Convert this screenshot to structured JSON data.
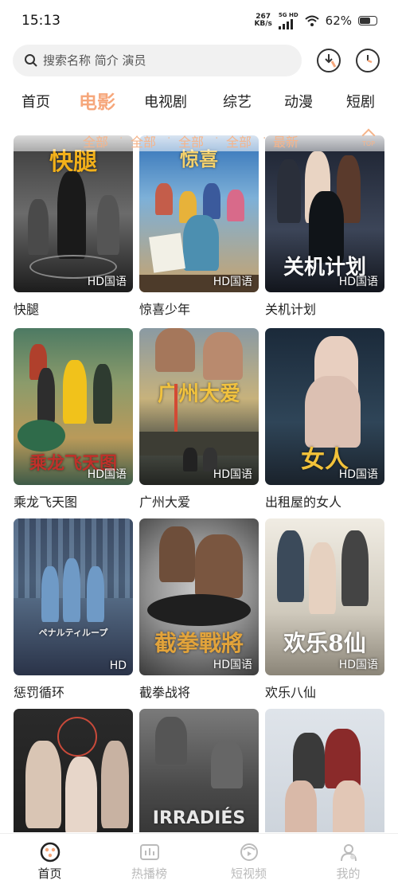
{
  "status": {
    "time": "15:13",
    "net_speed_value": "267",
    "net_speed_unit": "KB/s",
    "network_label": "5G HD",
    "battery": "62%"
  },
  "search": {
    "placeholder": "搜索名称 简介 演员"
  },
  "nav": {
    "tabs": [
      "首页",
      "电影",
      "电视剧",
      "综艺",
      "动漫",
      "短剧"
    ],
    "active": "电影"
  },
  "filters": [
    "全部",
    "全部",
    "全部",
    "全部",
    "最新"
  ],
  "top_button": "TOP",
  "movies": [
    {
      "title": "快腿",
      "badge": "HD国语",
      "poster_text": "快腿"
    },
    {
      "title": "惊喜少年",
      "badge": "HD国语",
      "poster_text": "惊喜"
    },
    {
      "title": "关机计划",
      "badge": "HD国语",
      "poster_text": "关机计划"
    },
    {
      "title": "乘龙飞天图",
      "badge": "HD国语",
      "poster_text": "乘龙飞天图"
    },
    {
      "title": "广州大爱",
      "badge": "HD国语",
      "poster_text": "广州大爱"
    },
    {
      "title": "出租屋的女人",
      "badge": "HD国语",
      "poster_text": "女人"
    },
    {
      "title": "惩罚循环",
      "badge": "HD",
      "poster_text": "ペナルティループ"
    },
    {
      "title": "截拳战将",
      "badge": "HD国语",
      "poster_text": "截拳戰將"
    },
    {
      "title": "欢乐八仙",
      "badge": "HD国语",
      "poster_text": "欢乐8仙"
    },
    {
      "title": "",
      "badge": "",
      "poster_text": ""
    },
    {
      "title": "",
      "badge": "",
      "poster_text": "IRRADIÉS"
    },
    {
      "title": "",
      "badge": "",
      "poster_text": ""
    }
  ],
  "bottom_nav": [
    {
      "label": "首页",
      "icon": "home-icon",
      "active": true
    },
    {
      "label": "热播榜",
      "icon": "chart-icon",
      "active": false
    },
    {
      "label": "短视频",
      "icon": "short-video-icon",
      "active": false
    },
    {
      "label": "我的",
      "icon": "profile-icon",
      "active": false
    }
  ],
  "colors": {
    "accent": "#f6a77b",
    "filter": "#f5b48a"
  }
}
